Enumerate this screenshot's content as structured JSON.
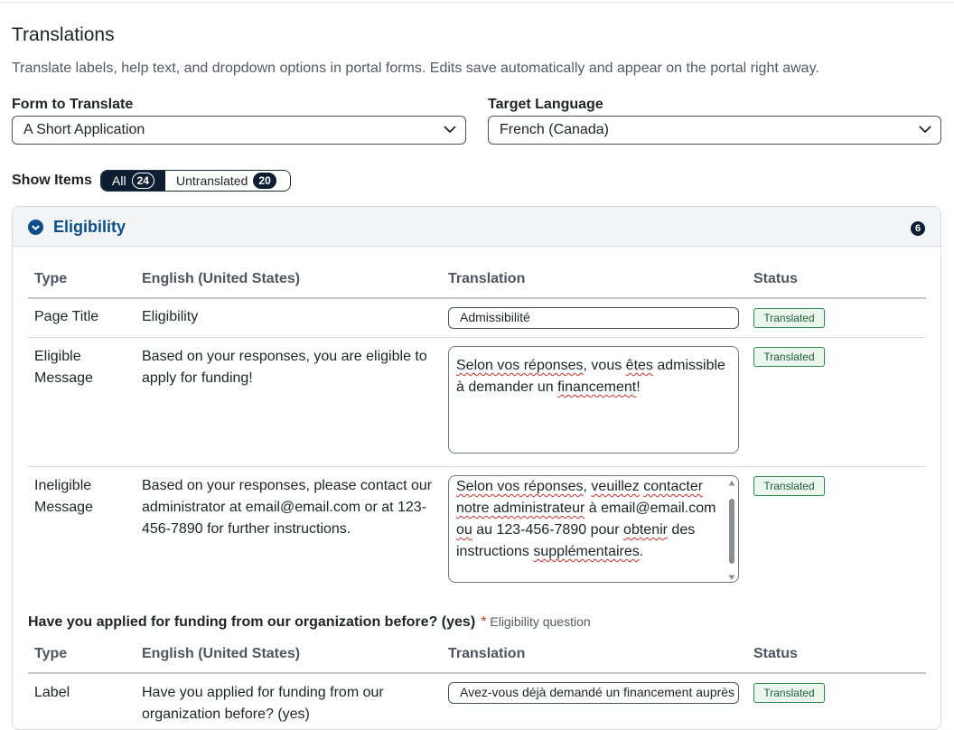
{
  "page": {
    "title": "Translations",
    "subtitle": "Translate labels, help text, and dropdown options in portal forms. Edits save automatically and appear on the portal right away."
  },
  "filters": {
    "form_label": "Form to Translate",
    "form_value": "A Short Application",
    "language_label": "Target Language",
    "language_value": "French (Canada)"
  },
  "show_items": {
    "label": "Show Items",
    "all_label": "All",
    "all_count": "24",
    "untranslated_label": "Untranslated",
    "untranslated_count": "20",
    "selected": "All"
  },
  "section": {
    "title": "Eligibility",
    "count": "6",
    "headers": {
      "type": "Type",
      "english": "English (United States)",
      "translation": "Translation",
      "status": "Status"
    },
    "rows": [
      {
        "type": "Page Title",
        "english": "Eligibility",
        "translation": "Admissibilité",
        "status": "Translated"
      },
      {
        "type": "Eligible Message",
        "english": "Based on your responses, you are eligible to apply for funding!",
        "translation": "Selon vos réponses, vous êtes admissible à demander un financement!",
        "status": "Translated"
      },
      {
        "type": "Ineligible Message",
        "english": "Based on your responses, please contact our administrator at email@email.com or at 123-456-7890 for further instructions.",
        "translation": "Selon vos réponses, veuillez contacter notre administrateur à email@email.com ou au 123-456-7890 pour obtenir des instructions supplémentaires.",
        "status": "Translated"
      }
    ],
    "question": {
      "text": "Have you applied for funding from our organization before? (yes)",
      "required_mark": "*",
      "note": "Eligibility question",
      "headers": {
        "type": "Type",
        "english": "English (United States)",
        "translation": "Translation",
        "status": "Status"
      },
      "rows": [
        {
          "type": "Label",
          "english": "Have you applied for funding from our organization before? (yes)",
          "translation": "Avez-vous déjà demandé un financement auprès de notre organisation? (oui)",
          "status": "Translated"
        }
      ]
    }
  },
  "colors": {
    "accent": "#0b4f8a",
    "segment_active": "#0d1e33",
    "status_border": "#2e8b4d",
    "status_bg": "#eaf6ee",
    "spell_error": "#d0302b"
  },
  "icons": {
    "select": "chevron-down-icon",
    "section": "chevron-down-circle-icon",
    "textarea_scroll": "scrollbar"
  }
}
